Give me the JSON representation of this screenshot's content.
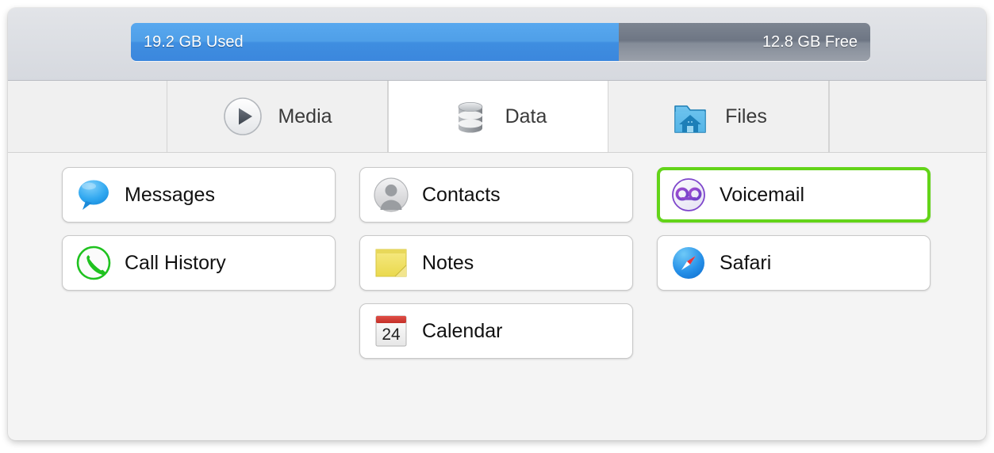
{
  "storage": {
    "used_label": "19.2 GB Used",
    "free_label": "12.8 GB Free",
    "used_gb": 19.2,
    "free_gb": 12.8,
    "used_percent": 66,
    "used_color": "#4a98e5",
    "free_color": "#7b838f"
  },
  "tabs": [
    {
      "label": "Media",
      "icon": "play-circle-icon",
      "active": false
    },
    {
      "label": "Data",
      "icon": "database-icon",
      "active": true
    },
    {
      "label": "Files",
      "icon": "folder-home-icon",
      "active": false
    }
  ],
  "content": {
    "selection_color": "#63d419",
    "rows": [
      [
        {
          "label": "Messages",
          "icon": "speech-bubble-icon",
          "selected": false
        },
        {
          "label": "Contacts",
          "icon": "person-avatar-icon",
          "selected": false
        },
        {
          "label": "Voicemail",
          "icon": "voicemail-tape-icon",
          "selected": true
        }
      ],
      [
        {
          "label": "Call History",
          "icon": "phone-handset-icon",
          "selected": false
        },
        {
          "label": "Notes",
          "icon": "sticky-note-icon",
          "selected": false
        },
        {
          "label": "Safari",
          "icon": "compass-icon",
          "selected": false
        }
      ],
      [
        {
          "label": "",
          "icon": "",
          "selected": false,
          "empty": true
        },
        {
          "label": "Calendar",
          "icon": "calendar-icon",
          "selected": false,
          "day": "24"
        },
        {
          "label": "",
          "icon": "",
          "selected": false,
          "empty": true
        }
      ]
    ]
  }
}
